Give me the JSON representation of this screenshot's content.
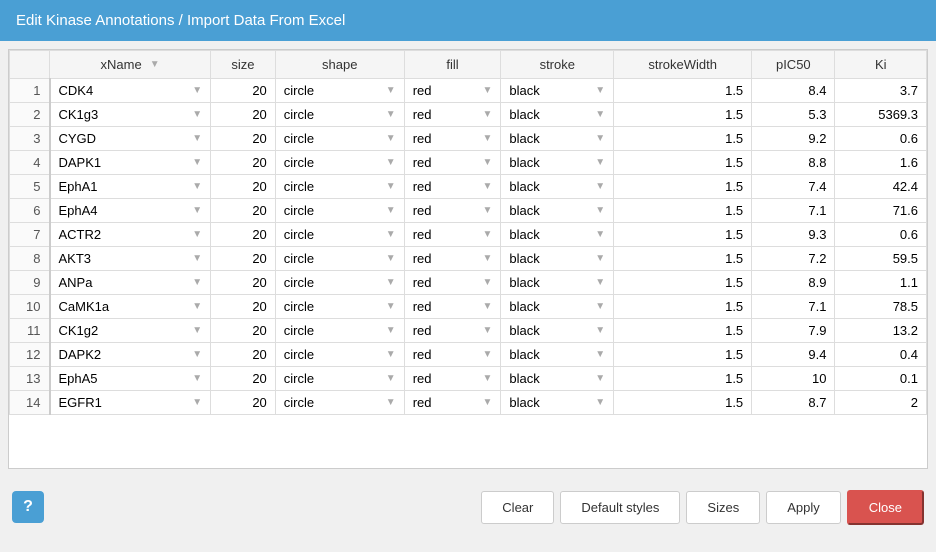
{
  "title": "Edit Kinase Annotations / Import Data From Excel",
  "table": {
    "columns": [
      {
        "key": "rownum",
        "label": "",
        "class": "row-num-header"
      },
      {
        "key": "xname",
        "label": "xName"
      },
      {
        "key": "size",
        "label": "size"
      },
      {
        "key": "shape",
        "label": "shape"
      },
      {
        "key": "fill",
        "label": "fill"
      },
      {
        "key": "stroke",
        "label": "stroke"
      },
      {
        "key": "strokeWidth",
        "label": "strokeWidth"
      },
      {
        "key": "pIC50",
        "label": "pIC50"
      },
      {
        "key": "ki",
        "label": "Ki"
      }
    ],
    "rows": [
      {
        "rownum": 1,
        "xname": "CDK4",
        "size": 20,
        "shape": "circle",
        "fill": "red",
        "stroke": "black",
        "strokeWidth": 1.5,
        "pIC50": 8.4,
        "ki": 3.7
      },
      {
        "rownum": 2,
        "xname": "CK1g3",
        "size": 20,
        "shape": "circle",
        "fill": "red",
        "stroke": "black",
        "strokeWidth": 1.5,
        "pIC50": 5.3,
        "ki": 5369.3
      },
      {
        "rownum": 3,
        "xname": "CYGD",
        "size": 20,
        "shape": "circle",
        "fill": "red",
        "stroke": "black",
        "strokeWidth": 1.5,
        "pIC50": 9.2,
        "ki": 0.6
      },
      {
        "rownum": 4,
        "xname": "DAPK1",
        "size": 20,
        "shape": "circle",
        "fill": "red",
        "stroke": "black",
        "strokeWidth": 1.5,
        "pIC50": 8.8,
        "ki": 1.6
      },
      {
        "rownum": 5,
        "xname": "EphA1",
        "size": 20,
        "shape": "circle",
        "fill": "red",
        "stroke": "black",
        "strokeWidth": 1.5,
        "pIC50": 7.4,
        "ki": 42.4
      },
      {
        "rownum": 6,
        "xname": "EphA4",
        "size": 20,
        "shape": "circle",
        "fill": "red",
        "stroke": "black",
        "strokeWidth": 1.5,
        "pIC50": 7.1,
        "ki": 71.6
      },
      {
        "rownum": 7,
        "xname": "ACTR2",
        "size": 20,
        "shape": "circle",
        "fill": "red",
        "stroke": "black",
        "strokeWidth": 1.5,
        "pIC50": 9.3,
        "ki": 0.6
      },
      {
        "rownum": 8,
        "xname": "AKT3",
        "size": 20,
        "shape": "circle",
        "fill": "red",
        "stroke": "black",
        "strokeWidth": 1.5,
        "pIC50": 7.2,
        "ki": 59.5
      },
      {
        "rownum": 9,
        "xname": "ANPa",
        "size": 20,
        "shape": "circle",
        "fill": "red",
        "stroke": "black",
        "strokeWidth": 1.5,
        "pIC50": 8.9,
        "ki": 1.1
      },
      {
        "rownum": 10,
        "xname": "CaMK1a",
        "size": 20,
        "shape": "circle",
        "fill": "red",
        "stroke": "black",
        "strokeWidth": 1.5,
        "pIC50": 7.1,
        "ki": 78.5
      },
      {
        "rownum": 11,
        "xname": "CK1g2",
        "size": 20,
        "shape": "circle",
        "fill": "red",
        "stroke": "black",
        "strokeWidth": 1.5,
        "pIC50": 7.9,
        "ki": 13.2
      },
      {
        "rownum": 12,
        "xname": "DAPK2",
        "size": 20,
        "shape": "circle",
        "fill": "red",
        "stroke": "black",
        "strokeWidth": 1.5,
        "pIC50": 9.4,
        "ki": 0.4
      },
      {
        "rownum": 13,
        "xname": "EphA5",
        "size": 20,
        "shape": "circle",
        "fill": "red",
        "stroke": "black",
        "strokeWidth": 1.5,
        "pIC50": 10.0,
        "ki": 0.1
      },
      {
        "rownum": 14,
        "xname": "EGFR1",
        "size": 20,
        "shape": "circle",
        "fill": "red",
        "stroke": "black",
        "strokeWidth": 1.5,
        "pIC50": 8.7,
        "ki": 2.0
      }
    ]
  },
  "footer": {
    "help_label": "?",
    "clear_label": "Clear",
    "default_styles_label": "Default styles",
    "sizes_label": "Sizes",
    "apply_label": "Apply",
    "close_label": "Close"
  }
}
